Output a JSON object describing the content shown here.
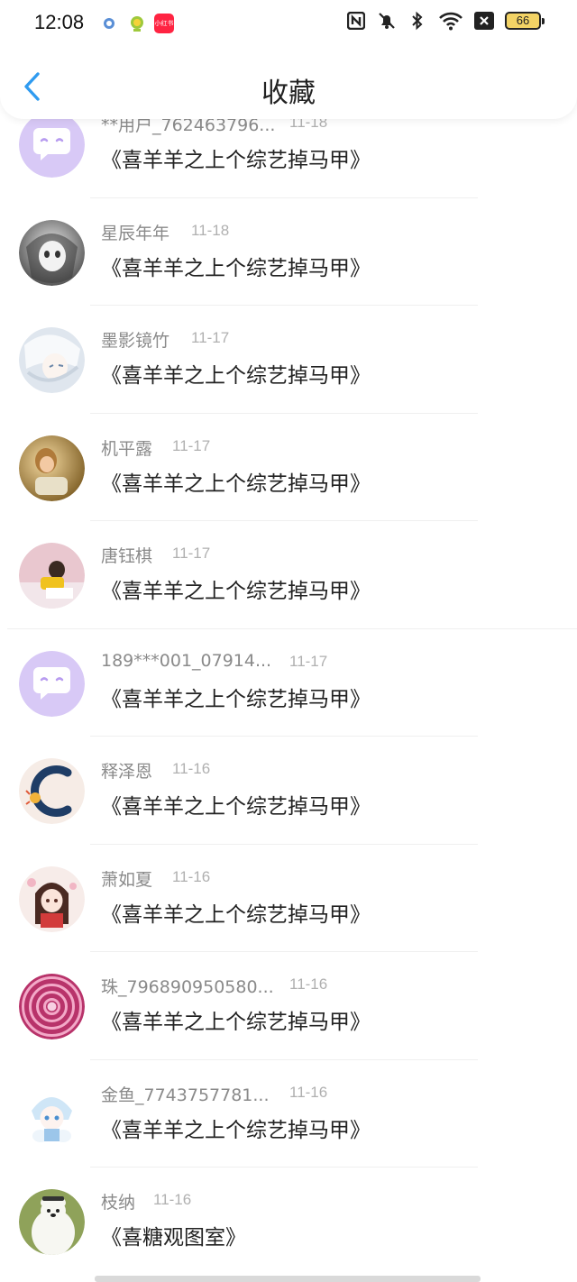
{
  "status_bar": {
    "time": "12:08",
    "battery_level": "66",
    "app3_label": "小红书",
    "icons": [
      "app-notification-1-icon",
      "app-notification-2-icon",
      "xiaohongshu-app-icon",
      "nfc-icon",
      "mute-bell-icon",
      "bluetooth-icon",
      "wifi-icon",
      "sim-off-icon",
      "battery-icon"
    ]
  },
  "header": {
    "title": "收藏",
    "back_icon": "chevron-left-icon"
  },
  "colors": {
    "accent": "#2f9bf0",
    "chat_avatar_bg": "#d8c9f6",
    "chat_bubble": "#b89cf0"
  },
  "favorites": [
    {
      "user": "**用户_762463796...",
      "date": "11-18",
      "title": "《喜羊羊之上个综艺掉马甲》",
      "avatar": "chat-bubble"
    },
    {
      "user": "星辰年年",
      "date": "11-18",
      "title": "《喜羊羊之上个综艺掉马甲》",
      "avatar": "anime-gray"
    },
    {
      "user": "墨影镜竹",
      "date": "11-17",
      "title": "《喜羊羊之上个综艺掉马甲》",
      "avatar": "anime-light"
    },
    {
      "user": "机平露",
      "date": "11-17",
      "title": "《喜羊羊之上个综艺掉马甲》",
      "avatar": "photo-warm"
    },
    {
      "user": "唐钰棋",
      "date": "11-17",
      "title": "《喜羊羊之上个综艺掉马甲》",
      "avatar": "photo-desk"
    },
    {
      "user": "189***001_07914...",
      "date": "11-17",
      "title": "《喜羊羊之上个综艺掉马甲》",
      "avatar": "chat-bubble"
    },
    {
      "user": "释泽恩",
      "date": "11-16",
      "title": "《喜羊羊之上个综艺掉马甲》",
      "avatar": "logo-c"
    },
    {
      "user": "萧如夏",
      "date": "11-16",
      "title": "《喜羊羊之上个综艺掉马甲》",
      "avatar": "anime-girl"
    },
    {
      "user": "珠_796890950580...",
      "date": "11-16",
      "title": "《喜羊羊之上个综艺掉马甲》",
      "avatar": "flower"
    },
    {
      "user": "金鱼_7743757781...",
      "date": "11-16",
      "title": "《喜羊羊之上个综艺掉马甲》",
      "avatar": "anime-blue"
    },
    {
      "user": "枝纳",
      "date": "11-16",
      "title": "《喜糖观图室》",
      "avatar": "polar-bear"
    }
  ]
}
